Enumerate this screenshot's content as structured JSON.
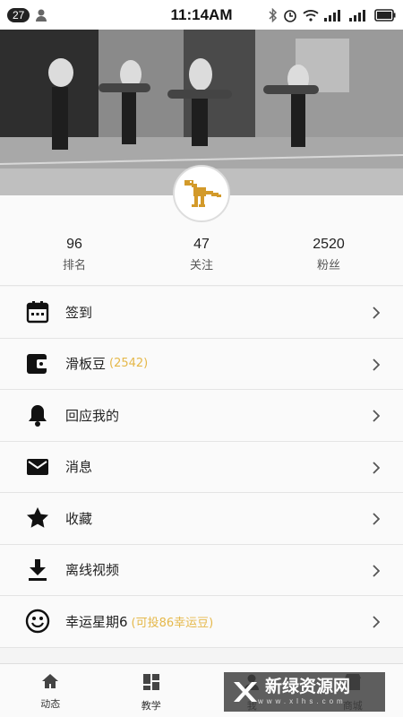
{
  "status_bar": {
    "notification_count": "27",
    "time": "11:14AM"
  },
  "profile": {
    "stats": [
      {
        "value": "96",
        "label": "排名"
      },
      {
        "value": "47",
        "label": "关注"
      },
      {
        "value": "2520",
        "label": "粉丝"
      }
    ]
  },
  "menu": {
    "items": [
      {
        "label": "签到",
        "icon": "calendar-icon"
      },
      {
        "label": "滑板豆",
        "extra": "(2542)",
        "icon": "wallet-icon"
      },
      {
        "label": "回应我的",
        "icon": "bell-icon"
      },
      {
        "label": "消息",
        "icon": "mail-icon"
      },
      {
        "label": "收藏",
        "icon": "star-icon"
      },
      {
        "label": "离线视频",
        "icon": "download-icon"
      },
      {
        "label": "幸运星期6",
        "extra": "(可投86幸运豆)",
        "icon": "smiley-icon"
      }
    ]
  },
  "tabbar": {
    "tabs": [
      {
        "label": "动态",
        "icon": "home-icon"
      },
      {
        "label": "教学",
        "icon": "grid-icon"
      },
      {
        "label": "我",
        "icon": "person-icon"
      },
      {
        "label": "商城",
        "icon": "shop-icon"
      }
    ]
  },
  "watermark": {
    "text": "新绿资源网",
    "sub": "www.xlhs.com"
  },
  "colors": {
    "accent_gold": "#e5b84a",
    "text": "#222222",
    "background": "#fafafa"
  }
}
